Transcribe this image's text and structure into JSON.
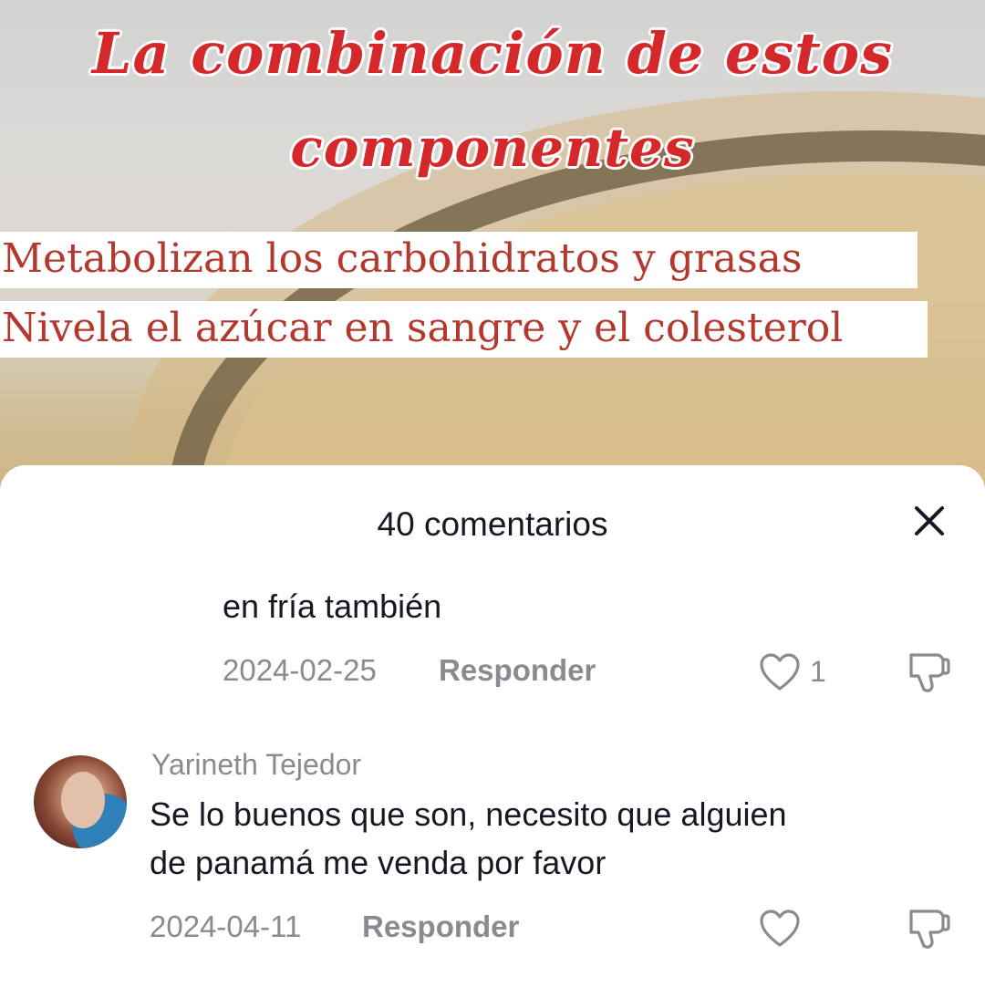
{
  "video": {
    "title_line1": "La combinación de estos",
    "title_line2": "componentes",
    "caption_line1": "Metabolizan los carbohidratos y grasas",
    "caption_line2": "Nivela el azúcar en sangre y el colesterol",
    "title_color": "#d4282a",
    "caption_color": "#b3392f"
  },
  "comments_sheet": {
    "title": "40 comentarios",
    "close_icon": "close-icon",
    "comments": [
      {
        "text": "en fría también",
        "date": "2024-02-25",
        "reply_label": "Responder",
        "like_count": "1"
      },
      {
        "author": "Yarineth Tejedor",
        "text_line1": "Se lo buenos que son, necesito que alguien",
        "text_line2": "de panamá me venda por favor",
        "date": "2024-04-11",
        "reply_label": "Responder",
        "like_count": ""
      }
    ]
  }
}
